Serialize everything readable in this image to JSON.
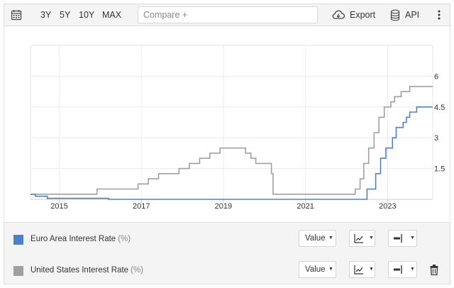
{
  "toolbar": {
    "ranges": [
      "3Y",
      "5Y",
      "10Y",
      "MAX"
    ],
    "compare_placeholder": "Compare +",
    "export_label": "Export",
    "api_label": "API"
  },
  "legend": {
    "items": [
      {
        "name": "Euro Area Interest Rate",
        "unit": "(%)",
        "color": "#4f81c7",
        "value_label": "Value"
      },
      {
        "name": "United States Interest Rate",
        "unit": "(%)",
        "color": "#a0a0a0",
        "value_label": "Value"
      }
    ]
  },
  "chart_data": {
    "type": "line",
    "x_ticks": [
      "2015",
      "2017",
      "2019",
      "2021",
      "2023"
    ],
    "y_ticks": [
      "1.5",
      "3",
      "4.5",
      "6"
    ],
    "xlim": [
      2014.3,
      2024.1
    ],
    "ylim": [
      0,
      7.5
    ],
    "y_axis_position": "right",
    "grid": true,
    "series": [
      {
        "name": "United States Interest Rate",
        "color": "#a0a0a0",
        "x": [
          2014.3,
          2015.92,
          2016.92,
          2017.17,
          2017.42,
          2017.92,
          2018.17,
          2018.42,
          2018.67,
          2018.92,
          2019.54,
          2019.67,
          2019.79,
          2020.17,
          2020.21,
          2022.21,
          2022.33,
          2022.42,
          2022.54,
          2022.67,
          2022.79,
          2022.92,
          2023.08,
          2023.17,
          2023.33,
          2023.54,
          2024.1
        ],
        "y": [
          0.25,
          0.5,
          0.75,
          1.0,
          1.25,
          1.5,
          1.75,
          2.0,
          2.25,
          2.5,
          2.25,
          2.0,
          1.75,
          1.25,
          0.25,
          0.5,
          1.0,
          1.75,
          2.5,
          3.25,
          4.0,
          4.5,
          4.75,
          5.0,
          5.25,
          5.5,
          5.5
        ]
      },
      {
        "name": "Euro Area Interest Rate",
        "color": "#4f81c7",
        "x": [
          2014.3,
          2014.42,
          2014.71,
          2016.2,
          2022.5,
          2022.71,
          2022.83,
          2022.96,
          2023.12,
          2023.21,
          2023.38,
          2023.46,
          2023.54,
          2023.71,
          2024.1
        ],
        "y": [
          0.25,
          0.15,
          0.05,
          0.0,
          0.5,
          1.25,
          2.0,
          2.5,
          3.0,
          3.5,
          3.75,
          4.0,
          4.25,
          4.5,
          4.5
        ]
      }
    ]
  }
}
